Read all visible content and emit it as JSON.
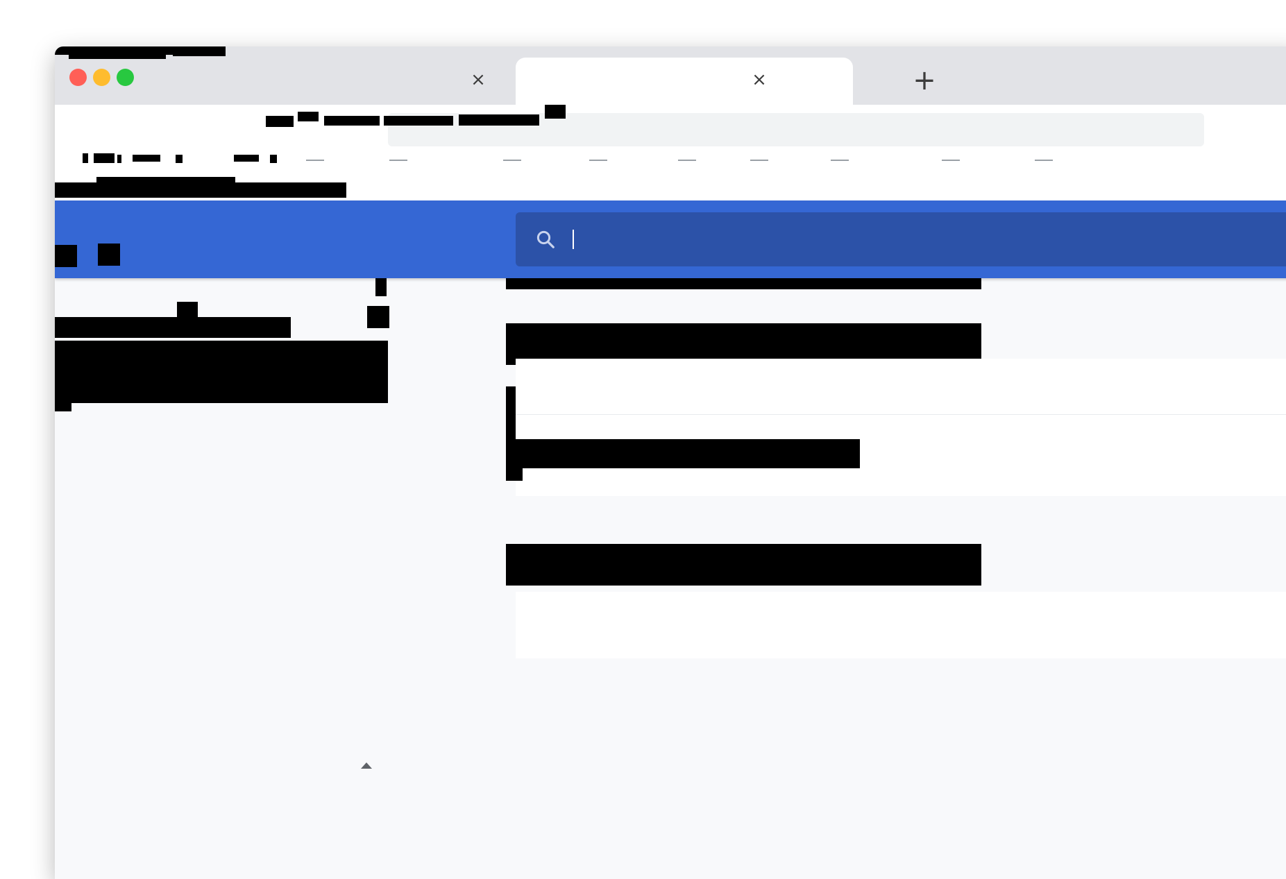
{
  "window": {
    "controls": [
      "close",
      "minimize",
      "maximize"
    ],
    "colors": {
      "close": "#ff5f57",
      "minimize": "#febc2e",
      "maximize": "#28c840"
    }
  },
  "tabs": [
    {
      "title": "",
      "close_icon": "×"
    },
    {
      "title": "",
      "close_icon": "×",
      "active": true
    }
  ],
  "new_tab_icon": "+",
  "address_bar": {
    "url": ""
  },
  "app_header": {
    "brand_color": "#3567d4",
    "search": {
      "value": "",
      "placeholder": "",
      "icon": "search-icon"
    }
  },
  "icons": [
    "close-icon",
    "plus-icon",
    "search-icon",
    "caret-up-icon"
  ]
}
